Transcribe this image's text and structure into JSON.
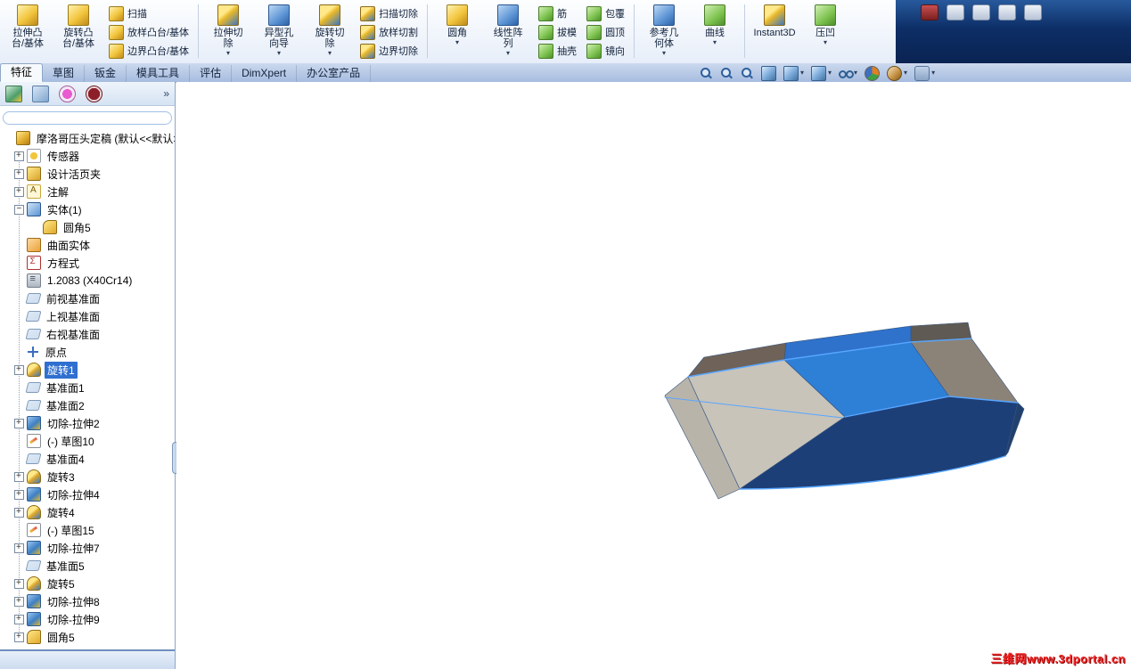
{
  "ribbon": {
    "cells": [
      {
        "type": "large",
        "name": "extruded-boss-base",
        "label": "拉伸凸\n台/基体",
        "color": "gold",
        "caret": false
      },
      {
        "type": "large",
        "name": "revolved-boss-base",
        "label": "旋转凸\n台/基体",
        "color": "gold",
        "caret": false
      },
      {
        "type": "col",
        "items": [
          {
            "name": "swept-boss-base",
            "label": "扫描",
            "color": "gold"
          },
          {
            "name": "lofted-boss-base",
            "label": "放样凸台/基体",
            "color": "gold"
          },
          {
            "name": "boundary-boss-base",
            "label": "边界凸台/基体",
            "color": "gold"
          }
        ]
      },
      {
        "type": "sep"
      },
      {
        "type": "large",
        "name": "extruded-cut",
        "label": "拉伸切\n除",
        "color": "goldblue",
        "caret": true
      },
      {
        "type": "large",
        "name": "hole-wizard",
        "label": "异型孔\n向导",
        "color": "blue",
        "caret": true
      },
      {
        "type": "large",
        "name": "revolved-cut",
        "label": "旋转切\n除",
        "color": "goldblue",
        "caret": true
      },
      {
        "type": "col",
        "items": [
          {
            "name": "swept-cut",
            "label": "扫描切除",
            "color": "goldblue"
          },
          {
            "name": "lofted-cut",
            "label": "放样切割",
            "color": "goldblue"
          },
          {
            "name": "boundary-cut",
            "label": "边界切除",
            "color": "goldblue"
          }
        ]
      },
      {
        "type": "sep"
      },
      {
        "type": "large",
        "name": "fillet",
        "label": "圆角",
        "color": "gold",
        "caret": true
      },
      {
        "type": "large",
        "name": "linear-pattern",
        "label": "线性阵\n列",
        "color": "blue",
        "caret": true
      },
      {
        "type": "col",
        "items": [
          {
            "name": "rib",
            "label": "筋",
            "color": "green"
          },
          {
            "name": "draft",
            "label": "拔模",
            "color": "green"
          },
          {
            "name": "shell",
            "label": "抽壳",
            "color": "green"
          }
        ]
      },
      {
        "type": "col",
        "items": [
          {
            "name": "wrap",
            "label": "包覆",
            "color": "green"
          },
          {
            "name": "dome",
            "label": "圆顶",
            "color": "green"
          },
          {
            "name": "mirror",
            "label": "镜向",
            "color": "green"
          }
        ]
      },
      {
        "type": "sep"
      },
      {
        "type": "large",
        "name": "reference-geometry",
        "label": "参考几\n何体",
        "color": "blue",
        "caret": true
      },
      {
        "type": "large",
        "name": "curves",
        "label": "曲线",
        "color": "green",
        "caret": true
      },
      {
        "type": "sep"
      },
      {
        "type": "large",
        "name": "instant3d",
        "label": "Instant3D",
        "color": "goldblue",
        "caret": false
      },
      {
        "type": "large",
        "name": "indent",
        "label": "压凹",
        "color": "green",
        "caret": true
      }
    ]
  },
  "titlebar": {
    "icons": [
      {
        "name": "sw-rx-logo-icon",
        "style": "red"
      },
      {
        "name": "nav-back-icon",
        "style": ""
      },
      {
        "name": "document-icon",
        "style": ""
      },
      {
        "name": "chart-icon",
        "style": ""
      },
      {
        "name": "notes-icon",
        "style": ""
      }
    ]
  },
  "tabs": {
    "items": [
      {
        "label": "特征",
        "active": true
      },
      {
        "label": "草图",
        "active": false
      },
      {
        "label": "钣金",
        "active": false
      },
      {
        "label": "模具工具",
        "active": false
      },
      {
        "label": "评估",
        "active": false
      },
      {
        "label": "DimXpert",
        "active": false
      },
      {
        "label": "办公室产品",
        "active": false
      }
    ]
  },
  "view_toolbar": {
    "items": [
      {
        "name": "zoom-to-fit",
        "glyph": "mag",
        "caret": false
      },
      {
        "name": "zoom-to-area",
        "glyph": "mag",
        "caret": false
      },
      {
        "name": "previous-view",
        "glyph": "mag",
        "caret": false
      },
      {
        "name": "section-view",
        "glyph": "cube",
        "caret": false
      },
      {
        "name": "view-orientation",
        "glyph": "cube",
        "caret": true
      },
      {
        "name": "display-style",
        "glyph": "cube",
        "caret": true
      },
      {
        "name": "hide-show-items",
        "glyph": "glasses",
        "caret": true
      },
      {
        "name": "edit-appearance",
        "glyph": "pie",
        "caret": false
      },
      {
        "name": "apply-scene",
        "glyph": "scene",
        "caret": true
      },
      {
        "name": "view-settings",
        "glyph": "cam",
        "caret": true
      }
    ]
  },
  "panel": {
    "tabs": [
      {
        "name": "featuremanager-tab",
        "color": "c1"
      },
      {
        "name": "propertymanager-tab",
        "color": "c2"
      },
      {
        "name": "configurationmanager-tab",
        "color": "c3"
      },
      {
        "name": "displaymanager-tab",
        "color": "c4"
      }
    ],
    "overflow_chevron": "»",
    "filter_placeholder": "",
    "tree": [
      {
        "label": "摩洛哥压头定稿 (默认<<默认>_",
        "icon": "part",
        "expand": "none",
        "level": 0,
        "selected": false
      },
      {
        "label": "传感器",
        "icon": "sensors",
        "expand": "plus",
        "level": 1,
        "selected": false
      },
      {
        "label": "设计活页夹",
        "icon": "design-binder",
        "expand": "plus",
        "level": 1,
        "selected": false
      },
      {
        "label": "注解",
        "icon": "annotations",
        "expand": "plus",
        "level": 1,
        "selected": false
      },
      {
        "label": "实体(1)",
        "icon": "solid-bodies",
        "expand": "minus",
        "level": 1,
        "selected": false
      },
      {
        "label": "圆角5",
        "icon": "fillet",
        "expand": "none",
        "level": 2,
        "selected": false
      },
      {
        "label": "曲面实体",
        "icon": "surface-bodies",
        "expand": "none",
        "level": 1,
        "selected": false
      },
      {
        "label": "方程式",
        "icon": "equations",
        "expand": "none",
        "level": 1,
        "selected": false
      },
      {
        "label": "1.2083 (X40Cr14)",
        "icon": "material",
        "expand": "none",
        "level": 1,
        "selected": false
      },
      {
        "label": "前视基准面",
        "icon": "plane",
        "expand": "none",
        "level": 1,
        "selected": false
      },
      {
        "label": "上视基准面",
        "icon": "plane",
        "expand": "none",
        "level": 1,
        "selected": false
      },
      {
        "label": "右视基准面",
        "icon": "plane",
        "expand": "none",
        "level": 1,
        "selected": false
      },
      {
        "label": "原点",
        "icon": "origin",
        "expand": "none",
        "level": 1,
        "selected": false
      },
      {
        "label": "旋转1",
        "icon": "revolve",
        "expand": "plus",
        "level": 1,
        "selected": true
      },
      {
        "label": "基准面1",
        "icon": "plane",
        "expand": "none",
        "level": 1,
        "selected": false
      },
      {
        "label": "基准面2",
        "icon": "plane",
        "expand": "none",
        "level": 1,
        "selected": false
      },
      {
        "label": "切除-拉伸2",
        "icon": "cut-extrude",
        "expand": "plus",
        "level": 1,
        "selected": false
      },
      {
        "label": "(-) 草图10",
        "icon": "sketch",
        "expand": "none",
        "level": 1,
        "selected": false
      },
      {
        "label": "基准面4",
        "icon": "plane",
        "expand": "none",
        "level": 1,
        "selected": false
      },
      {
        "label": "旋转3",
        "icon": "revolve",
        "expand": "plus",
        "level": 1,
        "selected": false
      },
      {
        "label": "切除-拉伸4",
        "icon": "cut-extrude",
        "expand": "plus",
        "level": 1,
        "selected": false
      },
      {
        "label": "旋转4",
        "icon": "revolve",
        "expand": "plus",
        "level": 1,
        "selected": false
      },
      {
        "label": "(-) 草图15",
        "icon": "sketch",
        "expand": "none",
        "level": 1,
        "selected": false
      },
      {
        "label": "切除-拉伸7",
        "icon": "cut-extrude",
        "expand": "plus",
        "level": 1,
        "selected": false
      },
      {
        "label": "基准面5",
        "icon": "plane",
        "expand": "none",
        "level": 1,
        "selected": false
      },
      {
        "label": "旋转5",
        "icon": "revolve",
        "expand": "plus",
        "level": 1,
        "selected": false
      },
      {
        "label": "切除-拉伸8",
        "icon": "cut-extrude",
        "expand": "plus",
        "level": 1,
        "selected": false
      },
      {
        "label": "切除-拉伸9",
        "icon": "cut-extrude",
        "expand": "plus",
        "level": 1,
        "selected": false
      },
      {
        "label": "圆角5",
        "icon": "fillet",
        "expand": "plus",
        "level": 1,
        "selected": false
      }
    ]
  },
  "model": {
    "colors": {
      "left_cap": "#b9b4aa",
      "left_slope": "#c8c4ba",
      "band_left": "#6e6259",
      "band_blue": "#2f72cc",
      "band_right": "#5f5a54",
      "top_selected": "#2e7fd6",
      "top_right": "#8b8378",
      "front": "#1d3f77",
      "right_cap": "#22406e",
      "edge": "#58a6ff"
    }
  },
  "watermark": {
    "text": "三维网www.3dportal.cn"
  }
}
